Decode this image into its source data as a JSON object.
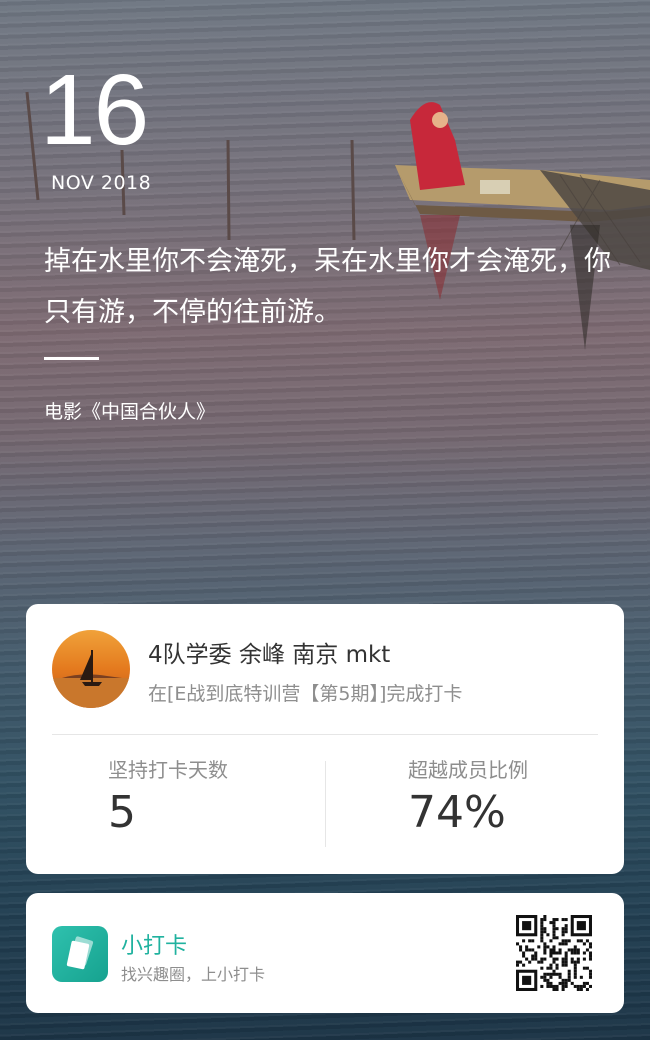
{
  "date": {
    "day": "16",
    "month_year": "NOV 2018"
  },
  "quote": {
    "text": "掉在水里你不会淹死，呆在水里你才会淹死，你只有游，不停的往前游。",
    "source": "电影《中国合伙人》"
  },
  "profile": {
    "username": "4队学委 余峰 南京 mkt",
    "checkin_text": "在[E战到底特训营【第5期】]完成打卡",
    "stats": [
      {
        "label": "坚持打卡天数",
        "value": "5"
      },
      {
        "label": "超越成员比例",
        "value": "74%"
      }
    ]
  },
  "app": {
    "name": "小打卡",
    "slogan": "找兴趣圈，上小打卡",
    "icon": "card-stack-icon",
    "accent": "#20b29f"
  },
  "icons": [
    "sailboat-avatar",
    "card-stack-icon",
    "qr-code"
  ]
}
